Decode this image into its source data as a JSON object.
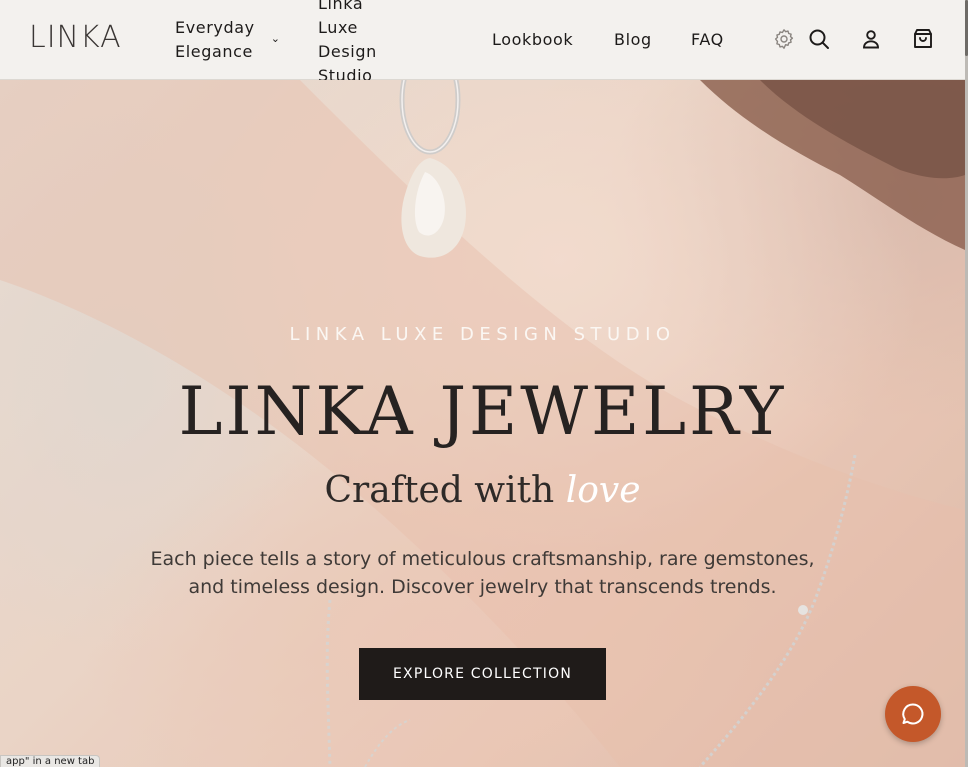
{
  "header": {
    "logo": "LINKA",
    "nav": [
      {
        "line1": "Everyday",
        "line2": "Elegance",
        "has_dropdown": true
      },
      {
        "line1": "Linka Luxe",
        "line2": "Design Studio",
        "has_dropdown": false
      },
      {
        "label": "Lookbook"
      },
      {
        "label": "Blog"
      },
      {
        "label": "FAQ"
      }
    ],
    "icons": [
      "gear-icon",
      "search-icon",
      "account-icon",
      "cart-icon"
    ],
    "dropdown_glyph": "⌄"
  },
  "hero": {
    "eyebrow": "LINKA LUXE DESIGN STUDIO",
    "title": "LINKA JEWELRY",
    "subtitle_prefix": "Crafted with",
    "subtitle_emphasis": "love",
    "description_line1": "Each piece tells a story of meticulous craftsmanship, rare gemstones,",
    "description_line2": "and timeless design. Discover jewelry that transcends trends.",
    "cta_label": "EXPLORE COLLECTION"
  },
  "chat": {
    "icon": "chat-bubble-icon"
  },
  "status_tip": "app\" in a new tab",
  "colors": {
    "header_bg": "#f3f1ee",
    "cta_bg": "#1f1b19",
    "chat_bg": "#c4582a",
    "text_dark": "#262221"
  }
}
